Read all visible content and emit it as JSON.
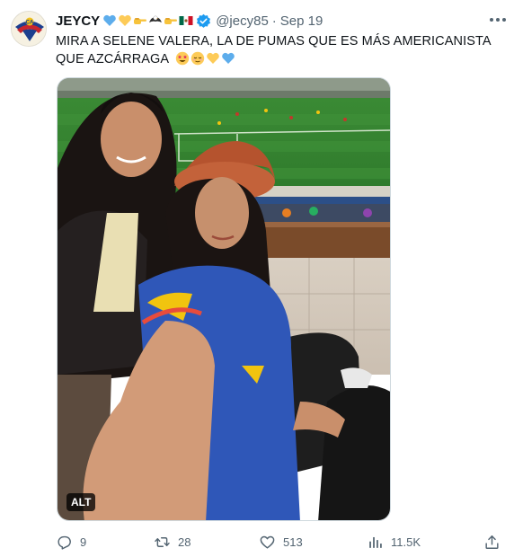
{
  "tweet": {
    "author_name": "JEYCY",
    "handle": "@jecy85",
    "separator": "·",
    "date": "Sep 19",
    "text": "MIRA A SELENE VALERA, LA DE PUMAS QUE ES MÁS AMERICANISTA QUE AZCÁRRAGA",
    "name_emojis": [
      "blue-heart",
      "yellow-heart",
      "pointing-right",
      "eagle",
      "pointing-right",
      "mexico-flag"
    ],
    "text_emojis": [
      "star-struck-face",
      "relieved-face",
      "yellow-heart",
      "blue-heart"
    ],
    "media_alt_badge": "ALT",
    "more_icon": "more-horizontal-icon"
  },
  "actions": {
    "reply_count": "9",
    "retweet_count": "28",
    "like_count": "513",
    "views_count": "11.5K"
  },
  "colors": {
    "text": "#0f1419",
    "secondary": "#536471",
    "verified": "#1d9bf0",
    "border": "#cfd9de"
  }
}
